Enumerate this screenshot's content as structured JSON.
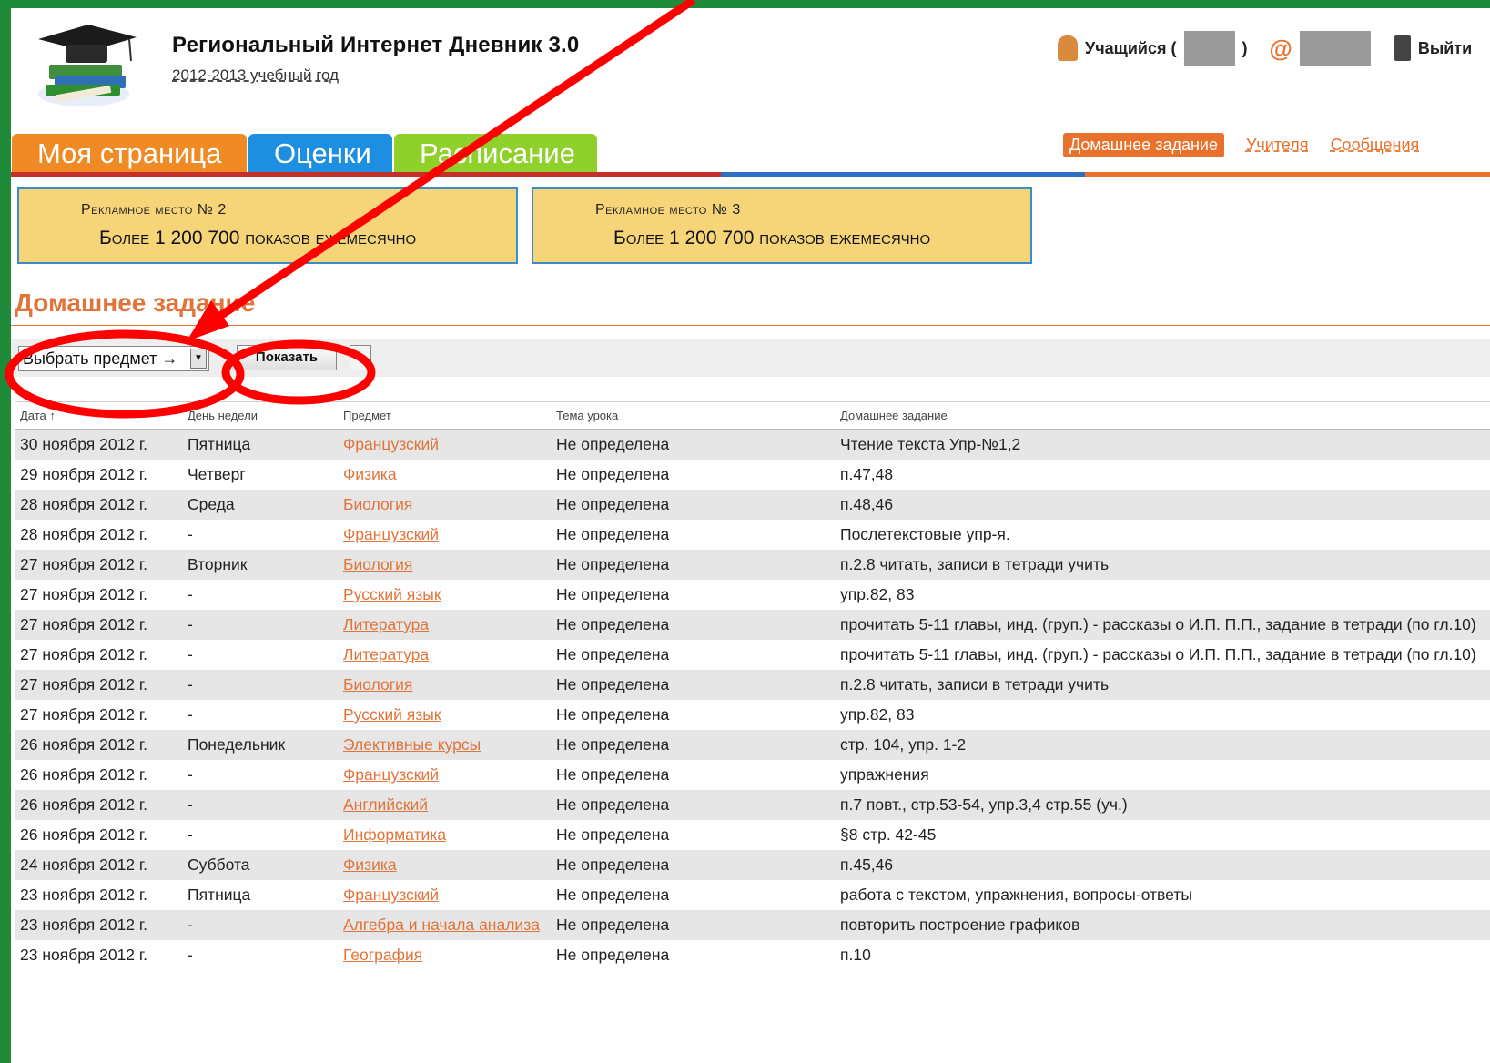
{
  "header": {
    "title": "Региональный Интернет Дневник 3.0",
    "year": "2012-2013 учебный год",
    "user_label": "Учащийся (",
    "user_close": ")",
    "logout_label": "Выйти"
  },
  "tabs": [
    {
      "label": "Моя страница",
      "color": "#f08a24"
    },
    {
      "label": "Оценки",
      "color": "#1e8ee0"
    },
    {
      "label": "Расписание",
      "color": "#8fd12a"
    }
  ],
  "nav": {
    "homework": "Домашнее задание",
    "teachers": "Учителя",
    "messages": "Сообщения"
  },
  "ads": [
    {
      "title": "Рекламное место № 2",
      "text": "Более 1 200 700 показов ежемесячно"
    },
    {
      "title": "Рекламное место № 3",
      "text": "Более 1 200 700 показов ежемесячно"
    }
  ],
  "section": {
    "title": "Домашнее задание",
    "select_value": "Выбрать предмет →",
    "show_button": "Показать"
  },
  "table": {
    "headers": [
      "Дата ↑",
      "День недели",
      "Предмет",
      "Тема урока",
      "Домашнее задание"
    ],
    "rows": [
      [
        "30 ноября 2012 г.",
        "Пятница",
        "Французский",
        "Не определена",
        "Чтение текста Упр-№1,2"
      ],
      [
        "29 ноября 2012 г.",
        "Четверг",
        "Физика",
        "Не определена",
        "п.47,48"
      ],
      [
        "28 ноября 2012 г.",
        "Среда",
        "Биология",
        "Не определена",
        "п.48,46"
      ],
      [
        "28 ноября 2012 г.",
        "-",
        "Французский",
        "Не определена",
        "Послетекстовые упр-я."
      ],
      [
        "27 ноября 2012 г.",
        "Вторник",
        "Биология",
        "Не определена",
        "п.2.8 читать, записи в тетради учить"
      ],
      [
        "27 ноября 2012 г.",
        "-",
        "Русский язык",
        "Не определена",
        "упр.82, 83"
      ],
      [
        "27 ноября 2012 г.",
        "-",
        "Литература",
        "Не определена",
        "прочитать 5-11 главы, инд. (груп.) - рассказы о И.П. П.П., задание в тетради (по гл.10)"
      ],
      [
        "27 ноября 2012 г.",
        "-",
        "Литература",
        "Не определена",
        "прочитать 5-11 главы, инд. (груп.) - рассказы о И.П. П.П., задание в тетради (по гл.10)"
      ],
      [
        "27 ноября 2012 г.",
        "-",
        "Биология",
        "Не определена",
        "п.2.8 читать, записи в тетради учить"
      ],
      [
        "27 ноября 2012 г.",
        "-",
        "Русский язык",
        "Не определена",
        "упр.82, 83"
      ],
      [
        "26 ноября 2012 г.",
        "Понедельник",
        "Элективные курсы",
        "Не определена",
        "стр. 104, упр. 1-2"
      ],
      [
        "26 ноября 2012 г.",
        "-",
        "Французский",
        "Не определена",
        "упражнения"
      ],
      [
        "26 ноября 2012 г.",
        "-",
        "Английский",
        "Не определена",
        "п.7 повт., стр.53-54, упр.3,4 стр.55 (уч.)"
      ],
      [
        "26 ноября 2012 г.",
        "-",
        "Информатика",
        "Не определена",
        "§8 стр. 42-45"
      ],
      [
        "24 ноября 2012 г.",
        "Суббота",
        "Физика",
        "Не определена",
        "п.45,46"
      ],
      [
        "23 ноября 2012 г.",
        "Пятница",
        "Французский",
        "Не определена",
        "работа с текстом, упражнения, вопросы-ответы"
      ],
      [
        "23 ноября 2012 г.",
        "-",
        "Алгебра и начала анализа",
        "Не определена",
        "повторить построение графиков"
      ],
      [
        "23 ноября 2012 г.",
        "-",
        "География",
        "Не определена",
        "п.10"
      ]
    ]
  },
  "colors": {
    "accent": "#e0743a",
    "frame": "#1e8a3a",
    "annotation": "#ff0000"
  }
}
